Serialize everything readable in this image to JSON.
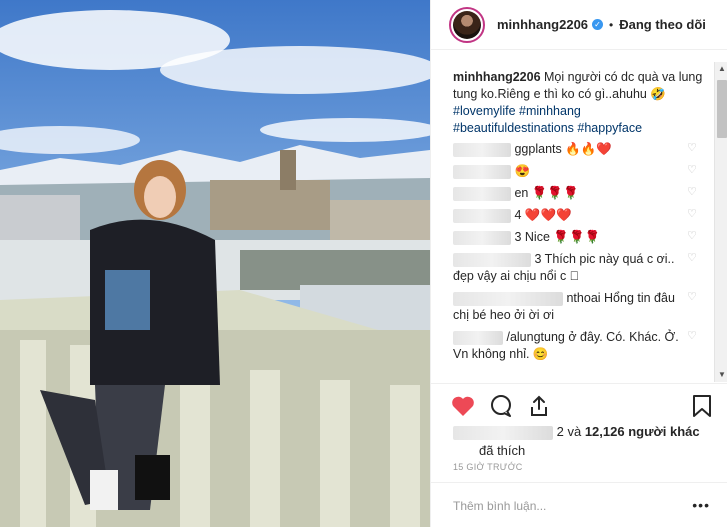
{
  "post": {
    "username": "minhhang2206",
    "verified_icon": "verified-badge-icon",
    "separator": "•",
    "follow_status": "Đang theo dõi"
  },
  "caption": {
    "username": "minhhang2206",
    "text": "Mọi người có dc quà va lung tung ko.Riêng e thì ko có gì..ahuhu 🤣",
    "hashtags_line1": "#lovemylife #minhhang",
    "hashtags_line2": "#beautifuldestinations #happyface"
  },
  "comments": [
    {
      "text": "ggplants 🔥🔥❤️"
    },
    {
      "text": "😍"
    },
    {
      "text": "en 🌹🌹🌹"
    },
    {
      "text": "4 ❤️❤️❤️"
    },
    {
      "text": "3 Nice 🌹🌹🌹"
    },
    {
      "text": "3 Thích pic này quá c ơi.. đẹp vậy ai chịu nổi c 🏽"
    },
    {
      "text": "nthoai Hổng tin đâu chị bé heo ởi ời ơi"
    },
    {
      "text": "/alungtung ở đây. Có. Khác. Ở. Vn không nhỉ. 😊"
    }
  ],
  "likes": {
    "prefix": "2 và",
    "count": "12,126",
    "suffix_line1": "người khác",
    "suffix_line2": "đã thích"
  },
  "timestamp": "15 GIỜ TRƯỚC",
  "add_comment": {
    "placeholder": "Thêm bình luận...",
    "more": "•••"
  },
  "colors": {
    "like_heart": "#ed4956",
    "link": "#003569",
    "verified": "#3897f0",
    "meta": "#999999"
  }
}
